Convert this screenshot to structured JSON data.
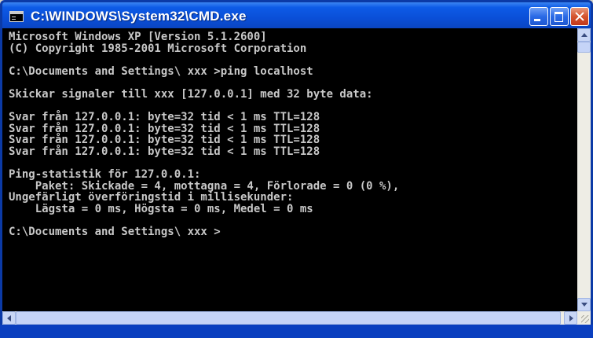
{
  "window": {
    "title": "C:\\WINDOWS\\System32\\CMD.exe"
  },
  "console": {
    "lines": [
      "Microsoft Windows XP [Version 5.1.2600]",
      "(C) Copyright 1985-2001 Microsoft Corporation",
      "",
      "C:\\Documents and Settings\\ xxx >ping localhost",
      "",
      "Skickar signaler till xxx [127.0.0.1] med 32 byte data:",
      "",
      "Svar från 127.0.0.1: byte=32 tid < 1 ms TTL=128",
      "Svar från 127.0.0.1: byte=32 tid < 1 ms TTL=128",
      "Svar från 127.0.0.1: byte=32 tid < 1 ms TTL=128",
      "Svar från 127.0.0.1: byte=32 tid < 1 ms TTL=128",
      "",
      "Ping-statistik för 127.0.0.1:",
      "    Paket: Skickade = 4, mottagna = 4, Förlorade = 0 (0 %),",
      "Ungefärligt överföringstid i millisekunder:",
      "    Lägsta = 0 ms, Högsta = 0 ms, Medel = 0 ms",
      "",
      "C:\\Documents and Settings\\ xxx >"
    ]
  },
  "icons": {
    "app": "cmd-app-icon",
    "minimize": "minimize-icon",
    "maximize": "maximize-icon",
    "close": "close-icon"
  },
  "colors": {
    "titlebar": "#0a4fd8",
    "console_bg": "#000000",
    "console_text": "#c8c8c8",
    "close_button": "#d4542e"
  }
}
